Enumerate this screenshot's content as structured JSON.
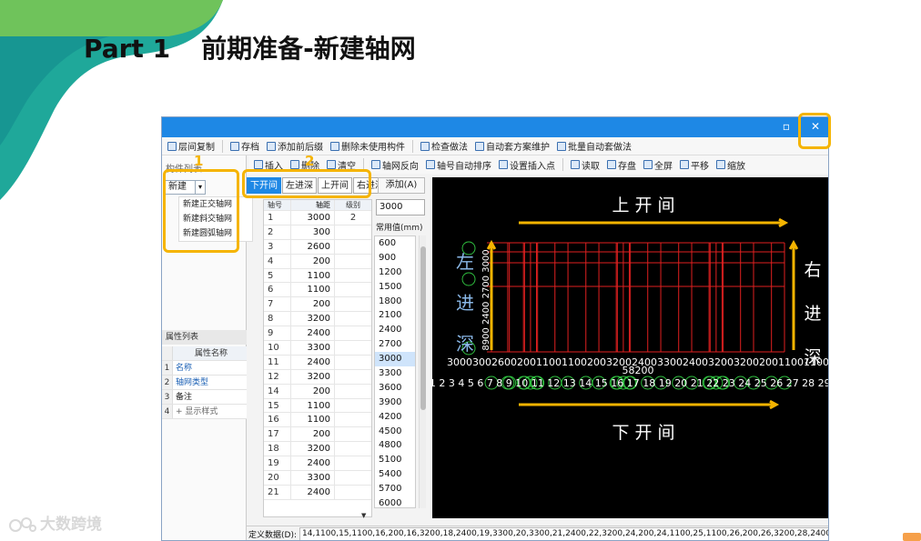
{
  "slide": {
    "title_part": "Part 1",
    "title_text": "前期准备-新建轴网",
    "watermark": "大数跨境"
  },
  "window": {
    "toolbar1": [
      "层间复制",
      "存档",
      "添加前后缀",
      "删除未使用构件",
      "检查做法",
      "自动套方案维护",
      "批量自动套做法"
    ],
    "toolbar2": [
      "插入",
      "删除",
      "清空",
      "轴网反向",
      "轴号自动排序",
      "设置插入点",
      "读取",
      "存盘",
      "全屏",
      "平移",
      "缩放"
    ],
    "close_glyph": "✕",
    "restore_glyph": "▫"
  },
  "left_panel": {
    "header": "构件列表",
    "new_button": "新建",
    "new_dropdown": "▾",
    "menu": [
      "新建正交轴网",
      "新建斜交轴网",
      "新建圆弧轴网"
    ],
    "prop_header": "属性列表",
    "prop_rows": [
      {
        "n": "",
        "v": "属性名称"
      },
      {
        "n": "1",
        "v": "名称"
      },
      {
        "n": "2",
        "v": "轴网类型"
      },
      {
        "n": "3",
        "v": "备注"
      },
      {
        "n": "4",
        "v": "+ 显示样式"
      }
    ]
  },
  "tabs": [
    "下开间",
    "左进深",
    "上开间",
    "右进深"
  ],
  "grid": {
    "headers": [
      "轴号",
      "轴距",
      "级别"
    ],
    "rows": [
      [
        "1",
        "3000",
        "2"
      ],
      [
        "2",
        "300",
        ""
      ],
      [
        "3",
        "2600",
        ""
      ],
      [
        "4",
        "200",
        ""
      ],
      [
        "5",
        "1100",
        ""
      ],
      [
        "6",
        "1100",
        ""
      ],
      [
        "7",
        "200",
        ""
      ],
      [
        "8",
        "3200",
        ""
      ],
      [
        "9",
        "2400",
        ""
      ],
      [
        "10",
        "3300",
        ""
      ],
      [
        "11",
        "2400",
        ""
      ],
      [
        "12",
        "3200",
        ""
      ],
      [
        "14",
        "200",
        ""
      ],
      [
        "15",
        "1100",
        ""
      ],
      [
        "16",
        "1100",
        ""
      ],
      [
        "17",
        "200",
        ""
      ],
      [
        "18",
        "3200",
        ""
      ],
      [
        "19",
        "2400",
        ""
      ],
      [
        "20",
        "3300",
        ""
      ],
      [
        "21",
        "2400",
        ""
      ]
    ],
    "scroll_glyph": "▼"
  },
  "mid_panel": {
    "add_button": "添加(A)",
    "input_value": "3000",
    "common_label": "常用值(mm)",
    "common_values": [
      "600",
      "900",
      "1200",
      "1500",
      "1800",
      "2100",
      "2400",
      "2700",
      "3000",
      "3300",
      "3600",
      "3900",
      "4200",
      "4500",
      "4800",
      "5100",
      "5400",
      "5700",
      "6000"
    ],
    "selected": "3000"
  },
  "canvas": {
    "top_label": "上 开 间",
    "bottom_label": "下 开 间",
    "left_label": [
      "左",
      "进",
      "深"
    ],
    "right_label": [
      "右",
      "进",
      "深"
    ],
    "total_dim": "58200",
    "axis_numbers": "1 2 3 4 5 6 7 8 9 10 11 12 13 14 15 16 17 18 19 20 21 22 23 24 25 26 27 28 29 30",
    "left_axis_letters": [
      "A",
      "B",
      "C",
      "D",
      "E"
    ],
    "left_dims": "8900 2400 2700 3000",
    "dim_row_text": "3000300260020011001100200320024003300240032003200200110011002003200240033002400320020011001100200320024003300"
  },
  "bottombar": {
    "label": "定义数据(D):",
    "value": "14,1100,15,1100,16,200,16,3200,18,2400,19,3300,20,3300,21,2400,22,3200,24,200,24,1100,25,1100,26,200,26,3200,28,2400,29,3300,30"
  },
  "annotations": {
    "num1": "1",
    "num2": "2",
    "highlight_color": "#f5b400"
  },
  "colors": {
    "accent": "#1e88e5",
    "canvas_bg": "#000000",
    "axis_red": "#e02020",
    "axis_green": "#2fbf3f",
    "arrow": "#f5b400",
    "canvas_text": "#ffffff",
    "side_text": "#8ab8e8"
  }
}
